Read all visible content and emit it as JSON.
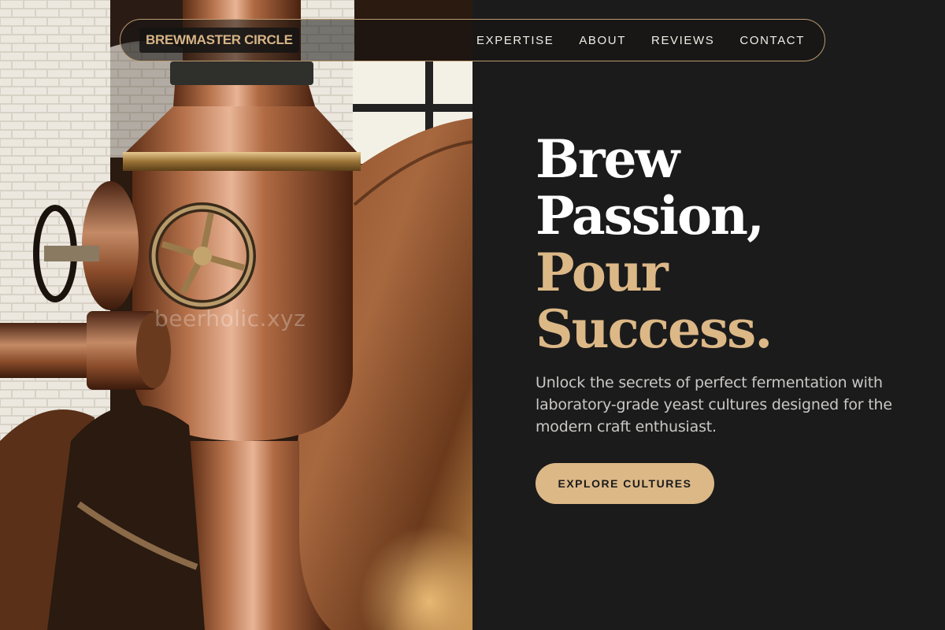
{
  "nav": {
    "brand": "BREWMASTER CIRCLE",
    "links": [
      "EXPERTISE",
      "ABOUT",
      "REVIEWS",
      "CONTACT"
    ]
  },
  "hero": {
    "headline_line1": "Brew",
    "headline_line2": "Passion,",
    "headline_line3": "Pour",
    "headline_line4": "Success.",
    "subtitle": "Unlock the secrets of perfect fermentation with laboratory-grade yeast cultures designed for the modern craft enthusiast.",
    "cta_label": "EXPLORE CULTURES"
  },
  "image": {
    "watermark": "beerholic.xyz",
    "subject": "copper-brewing-kettle-photo"
  },
  "colors": {
    "background": "#1b1b1b",
    "accent_gold": "#dcb887",
    "nav_border": "#b99a70",
    "text_white": "#ffffff",
    "text_muted": "#c9c8c6"
  }
}
